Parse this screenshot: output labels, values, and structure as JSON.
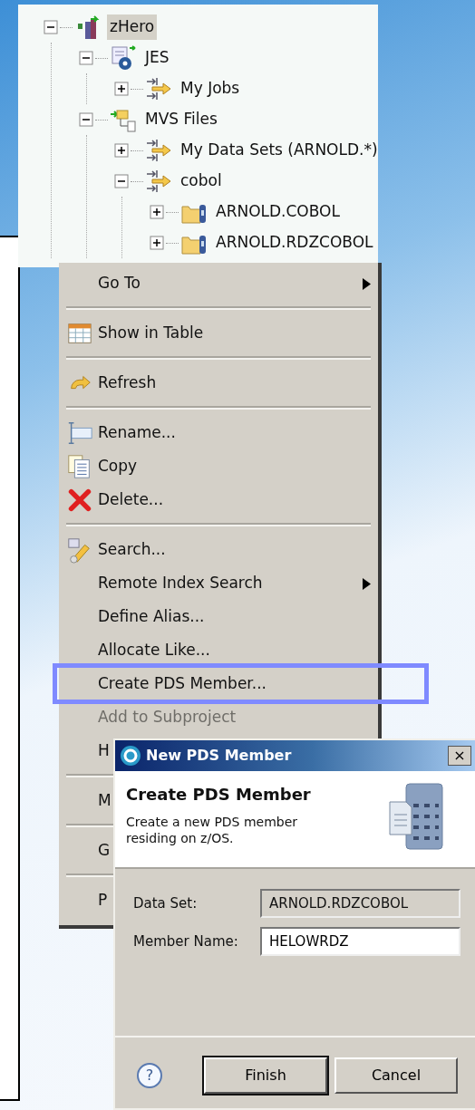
{
  "tree": {
    "nodes": [
      {
        "label": "zHero",
        "kind": "system",
        "expanded": true,
        "selected": true,
        "children": [
          {
            "label": "JES",
            "kind": "jes",
            "expanded": true,
            "selected": false,
            "children": [
              {
                "label": "My Jobs",
                "kind": "filter",
                "expanded": false,
                "selected": false
              }
            ]
          },
          {
            "label": "MVS Files",
            "kind": "mvs",
            "expanded": true,
            "selected": false,
            "children": [
              {
                "label": "My Data Sets (ARNOLD.*)",
                "kind": "filter",
                "expanded": false,
                "selected": false
              },
              {
                "label": "cobol",
                "kind": "filter",
                "expanded": true,
                "selected": false,
                "children": [
                  {
                    "label": "ARNOLD.COBOL",
                    "kind": "dataset",
                    "expanded": false,
                    "selected": false
                  },
                  {
                    "label": "ARNOLD.RDZCOBOL",
                    "kind": "dataset",
                    "expanded": false,
                    "selected": false
                  }
                ]
              }
            ]
          }
        ]
      }
    ]
  },
  "context_menu": {
    "sections": [
      [
        {
          "label": "Go To",
          "kind": "plain",
          "submenu": true,
          "disabled": false,
          "selected": false
        }
      ],
      [
        {
          "label": "Show in Table",
          "kind": "table",
          "submenu": false,
          "disabled": false,
          "selected": false
        }
      ],
      [
        {
          "label": "Refresh",
          "kind": "refresh",
          "submenu": false,
          "disabled": false,
          "selected": false
        }
      ],
      [
        {
          "label": "Rename...",
          "kind": "rename",
          "submenu": false,
          "disabled": false,
          "selected": false
        },
        {
          "label": "Copy",
          "kind": "copy",
          "submenu": false,
          "disabled": false,
          "selected": false
        },
        {
          "label": "Delete...",
          "kind": "delete",
          "submenu": false,
          "disabled": false,
          "selected": false
        }
      ],
      [
        {
          "label": "Search...",
          "kind": "search",
          "submenu": false,
          "disabled": false,
          "selected": false
        },
        {
          "label": "Remote Index Search",
          "kind": "plain",
          "submenu": true,
          "disabled": false,
          "selected": false
        },
        {
          "label": "Define Alias...",
          "kind": "plain",
          "submenu": false,
          "disabled": false,
          "selected": false
        },
        {
          "label": "Allocate Like...",
          "kind": "plain",
          "submenu": false,
          "disabled": false,
          "selected": false
        },
        {
          "label": "Create PDS Member...",
          "kind": "plain",
          "submenu": false,
          "disabled": false,
          "selected": true
        },
        {
          "label": "Add to Subproject",
          "kind": "plain",
          "submenu": false,
          "disabled": true,
          "selected": false
        },
        {
          "label": "H",
          "kind": "plain",
          "submenu": false,
          "disabled": false,
          "selected": false
        }
      ],
      [
        {
          "label": "M",
          "kind": "plain",
          "submenu": false,
          "disabled": false,
          "selected": false
        }
      ],
      [
        {
          "label": "G",
          "kind": "plain",
          "submenu": false,
          "disabled": false,
          "selected": false
        }
      ],
      [
        {
          "label": "P",
          "kind": "plain",
          "submenu": false,
          "disabled": false,
          "selected": false
        }
      ]
    ]
  },
  "dialog": {
    "title": "New PDS Member",
    "close": "×",
    "help": "?",
    "heading": "Create PDS Member",
    "description": "Create a new PDS member residing on z/OS.",
    "fields": [
      {
        "label": "Data Set:",
        "value": "ARNOLD.RDZCOBOL",
        "disabled": true
      },
      {
        "label": "Member Name:",
        "value": "HELOWRDZ",
        "disabled": false
      }
    ],
    "buttons": [
      {
        "label": "Finish",
        "default": true
      },
      {
        "label": "Cancel",
        "default": false
      }
    ]
  }
}
